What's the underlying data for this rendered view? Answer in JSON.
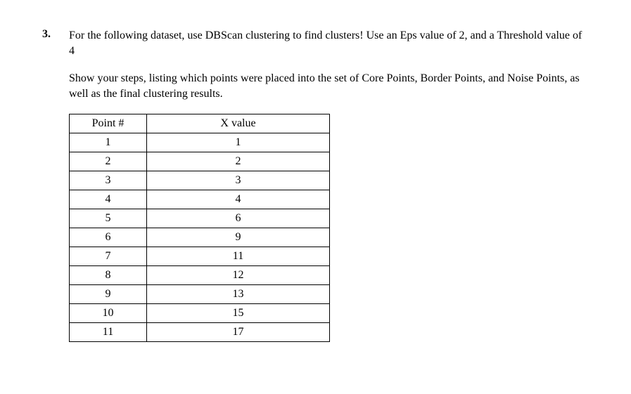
{
  "question": {
    "number": "3.",
    "para1": "For the following dataset, use DBScan clustering to find clusters!  Use an Eps value of 2, and a Threshold value of 4",
    "para2": "Show your steps, listing which points were placed into the set of Core Points, Border Points, and Noise Points, as well as the final clustering results."
  },
  "table": {
    "headers": {
      "point": "Point #",
      "xvalue": "X value"
    },
    "rows": [
      {
        "point": "1",
        "xvalue": "1"
      },
      {
        "point": "2",
        "xvalue": "2"
      },
      {
        "point": "3",
        "xvalue": "3"
      },
      {
        "point": "4",
        "xvalue": "4"
      },
      {
        "point": "5",
        "xvalue": "6"
      },
      {
        "point": "6",
        "xvalue": "9"
      },
      {
        "point": "7",
        "xvalue": "11"
      },
      {
        "point": "8",
        "xvalue": "12"
      },
      {
        "point": "9",
        "xvalue": "13"
      },
      {
        "point": "10",
        "xvalue": "15"
      },
      {
        "point": "11",
        "xvalue": "17"
      }
    ]
  }
}
